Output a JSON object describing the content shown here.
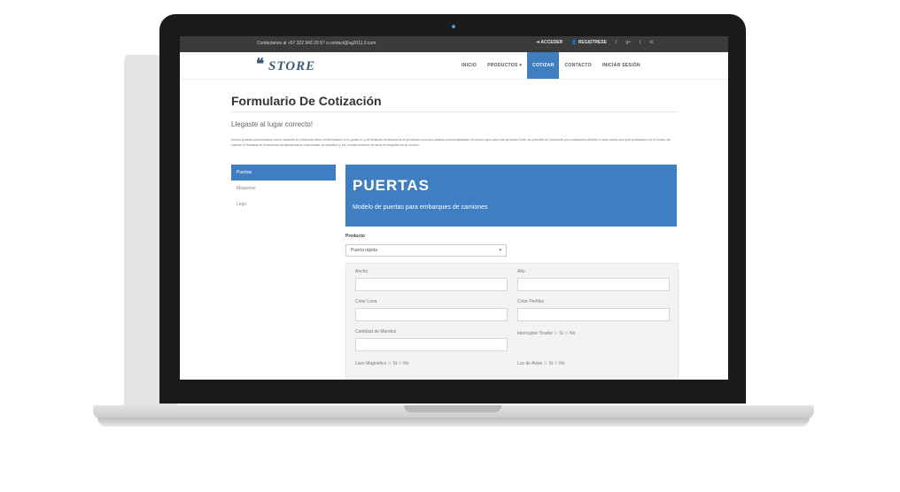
{
  "topbar": {
    "contact": "Contáctanos al +57 322 943 20 67 o contact@sg2011.3.com",
    "login": "ACCEDER",
    "register": "REGISTRESE",
    "social": [
      "f",
      "g+",
      "t",
      "in"
    ]
  },
  "nav": {
    "logo_mark": "❝",
    "logo_text": "STORE",
    "items": [
      {
        "label": "INICIO"
      },
      {
        "label": "PRODUCTOS ▾"
      },
      {
        "label": "COTIZAR"
      },
      {
        "label": "CONTACTO"
      },
      {
        "label": "INICIAR SESIÓN"
      }
    ]
  },
  "page": {
    "title": "Formulario De Cotización",
    "subtitle": "Llegaste al lugar correcto!",
    "intro": "Ahora podras personalizar como desees tu producto,llena el formulario a tu gusto el y al finalizar enviaremos el producto con sus planos personalizados al correo que nos has provisto.Solo se permite un producto por cotización,debido a esto cada vez que presiones en el boton de cotizar el finalizar el formulario empezaremos a procesar tu solicitud y en cuanto termine te sera entregada en tu correo."
  },
  "sidebar": {
    "items": [
      {
        "label": "Puertas"
      },
      {
        "label": "Maquinas"
      },
      {
        "label": "Lego"
      }
    ]
  },
  "hero": {
    "title": "PUERTAS",
    "subtitle": "Modelo de puertas para embarques de camiones"
  },
  "form": {
    "product_label": "Producto",
    "product_value": "Puerta rápida",
    "fields": {
      "ancho": "Ancho",
      "alto": "Alto",
      "color_lona": "Color Lona",
      "color_perfiles": "Color Perfiles",
      "cantidad_mandos": "Cantidad de Mandos",
      "interruptor_tirador": "Interruptor Tirador ☉ Si ☉ No",
      "lazo_magnetico": "Lazo Magnetico ☉ Si ☉ No",
      "luz_aviso": "Luz de Aviso ☉ Si ☉ No"
    }
  },
  "colors": {
    "accent": "#3e7ec1",
    "topbar": "#3b3b3b"
  }
}
